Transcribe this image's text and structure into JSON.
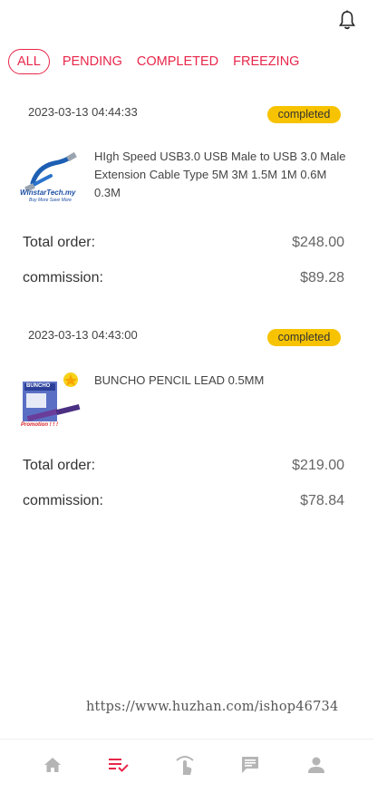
{
  "header": {
    "bell_icon": "bell-outline-icon"
  },
  "tabs": [
    {
      "label": "ALL",
      "active": true
    },
    {
      "label": "PENDING",
      "active": false
    },
    {
      "label": "COMPLETED",
      "active": false
    },
    {
      "label": "FREEZING",
      "active": false
    }
  ],
  "orders": [
    {
      "date": "2023-03-13 04:44:33",
      "status": "completed",
      "product_name": "HIgh Speed USB3.0 USB Male to USB 3.0 Male Extension Cable Type 5M 3M 1.5M 1M 0.6M 0.3M",
      "image_caption": "WinstarTech.my",
      "image_subcaption": "Buy More Save More",
      "total_label": "Total order:",
      "total_value": "$248.00",
      "commission_label": "commission:",
      "commission_value": "$89.28"
    },
    {
      "date": "2023-03-13 04:43:00",
      "status": "completed",
      "product_name": "BUNCHO PENCIL LEAD 0.5MM",
      "image_caption": "BUNCHO",
      "image_subcaption": "Promotion ! ! !",
      "total_label": "Total order:",
      "total_value": "$219.00",
      "commission_label": "commission:",
      "commission_value": "$78.84"
    }
  ],
  "watermark": "https://www.huzhan.com/ishop46734",
  "bottom_nav": [
    {
      "icon": "home-icon",
      "active": false
    },
    {
      "icon": "orders-list-check-icon",
      "active": true
    },
    {
      "icon": "tap-hand-icon",
      "active": false
    },
    {
      "icon": "message-icon",
      "active": false
    },
    {
      "icon": "user-icon",
      "active": false
    }
  ],
  "colors": {
    "accent": "#e8264a",
    "badge": "#f7c300",
    "nav_inactive": "#b5b5b5"
  }
}
